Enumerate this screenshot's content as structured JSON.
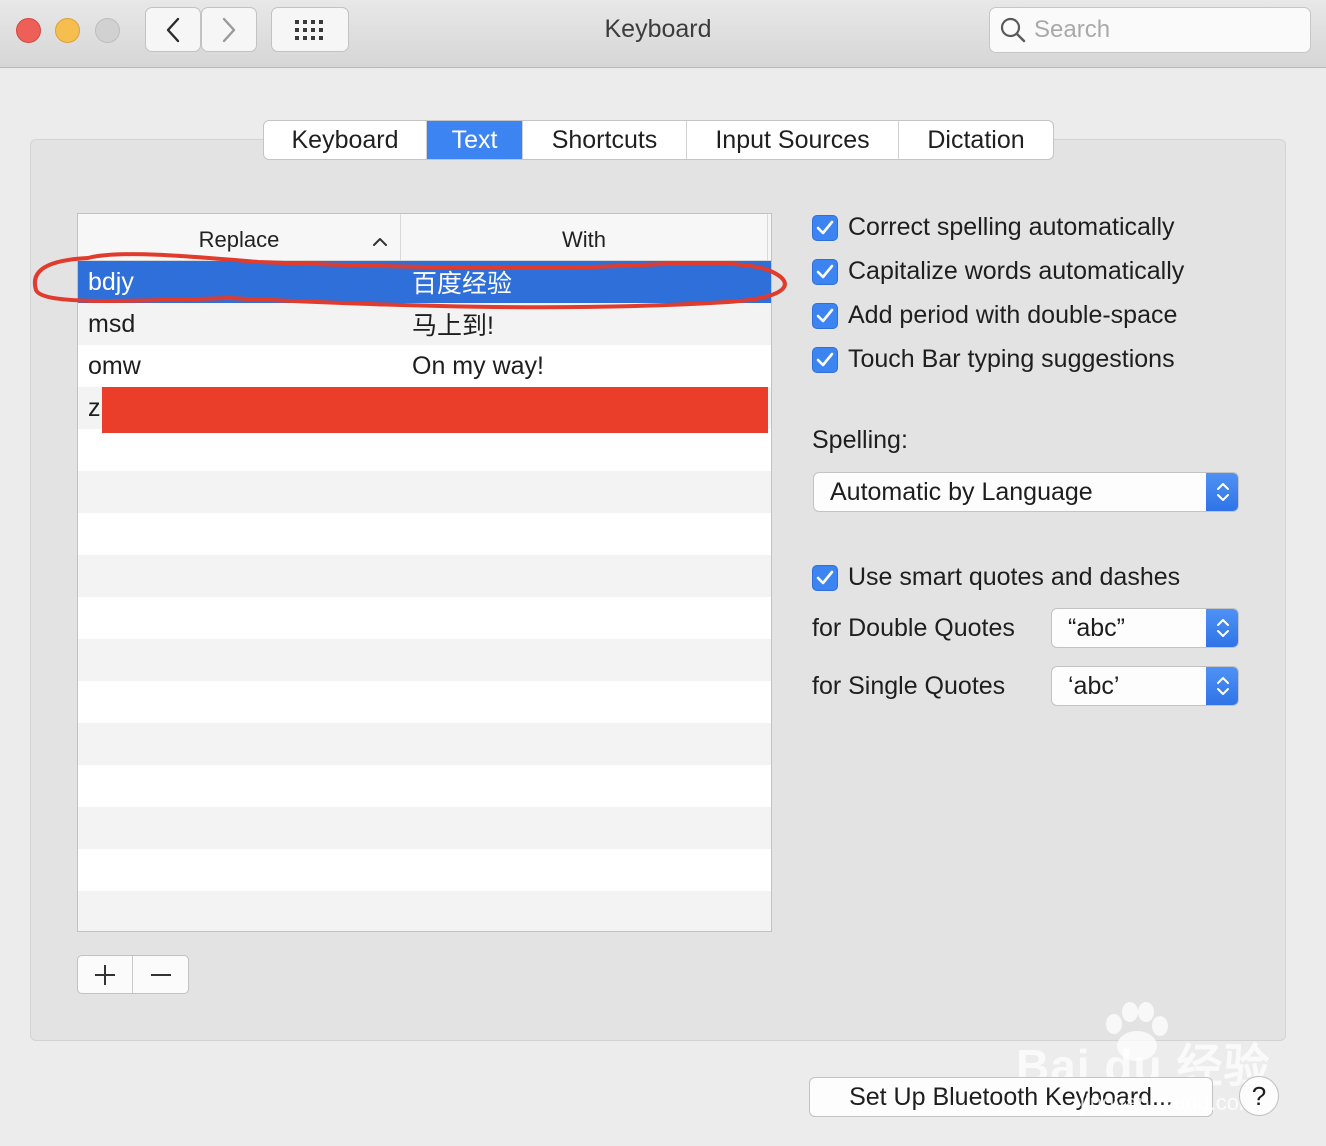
{
  "window": {
    "title": "Keyboard"
  },
  "search": {
    "placeholder": "Search"
  },
  "tabs": [
    {
      "label": "Keyboard",
      "active": false
    },
    {
      "label": "Text",
      "active": true
    },
    {
      "label": "Shortcuts",
      "active": false
    },
    {
      "label": "Input Sources",
      "active": false
    },
    {
      "label": "Dictation",
      "active": false
    }
  ],
  "table": {
    "headers": {
      "replace": "Replace",
      "with": "With"
    },
    "rows": [
      {
        "replace": "bdjy",
        "with": "百度经验",
        "selected": true
      },
      {
        "replace": "msd",
        "with": "马上到!",
        "selected": false
      },
      {
        "replace": "omw",
        "with": "On my way!",
        "selected": false
      },
      {
        "replace": "z",
        "with": "",
        "selected": false,
        "redacted": true
      }
    ]
  },
  "options": {
    "correct_spelling": "Correct spelling automatically",
    "capitalize_words": "Capitalize words automatically",
    "add_period": "Add period with double-space",
    "touch_bar": "Touch Bar typing suggestions",
    "spelling_label": "Spelling:",
    "spelling_value": "Automatic by Language",
    "smart_quotes": "Use smart quotes and dashes",
    "double_quotes_label": "for Double Quotes",
    "double_quotes_value": "“abc”",
    "single_quotes_label": "for Single Quotes",
    "single_quotes_value": "‘abc’"
  },
  "footer": {
    "bluetooth_button": "Set Up Bluetooth Keyboard...",
    "help_button": "?"
  },
  "watermark": {
    "brand": "Bai du 经验",
    "url": "jingyan.baidu.com"
  },
  "colors": {
    "accent": "#3d84f3",
    "selection": "#2e6fd9",
    "annotation": "#e03b2c",
    "redaction": "#ea3e2a"
  },
  "icons": [
    "back-icon",
    "forward-icon",
    "grid-icon",
    "search-icon",
    "sort-ascending-icon",
    "plus-icon",
    "minus-icon",
    "checkmark-icon",
    "popup-arrows-icon",
    "paw-icon"
  ]
}
